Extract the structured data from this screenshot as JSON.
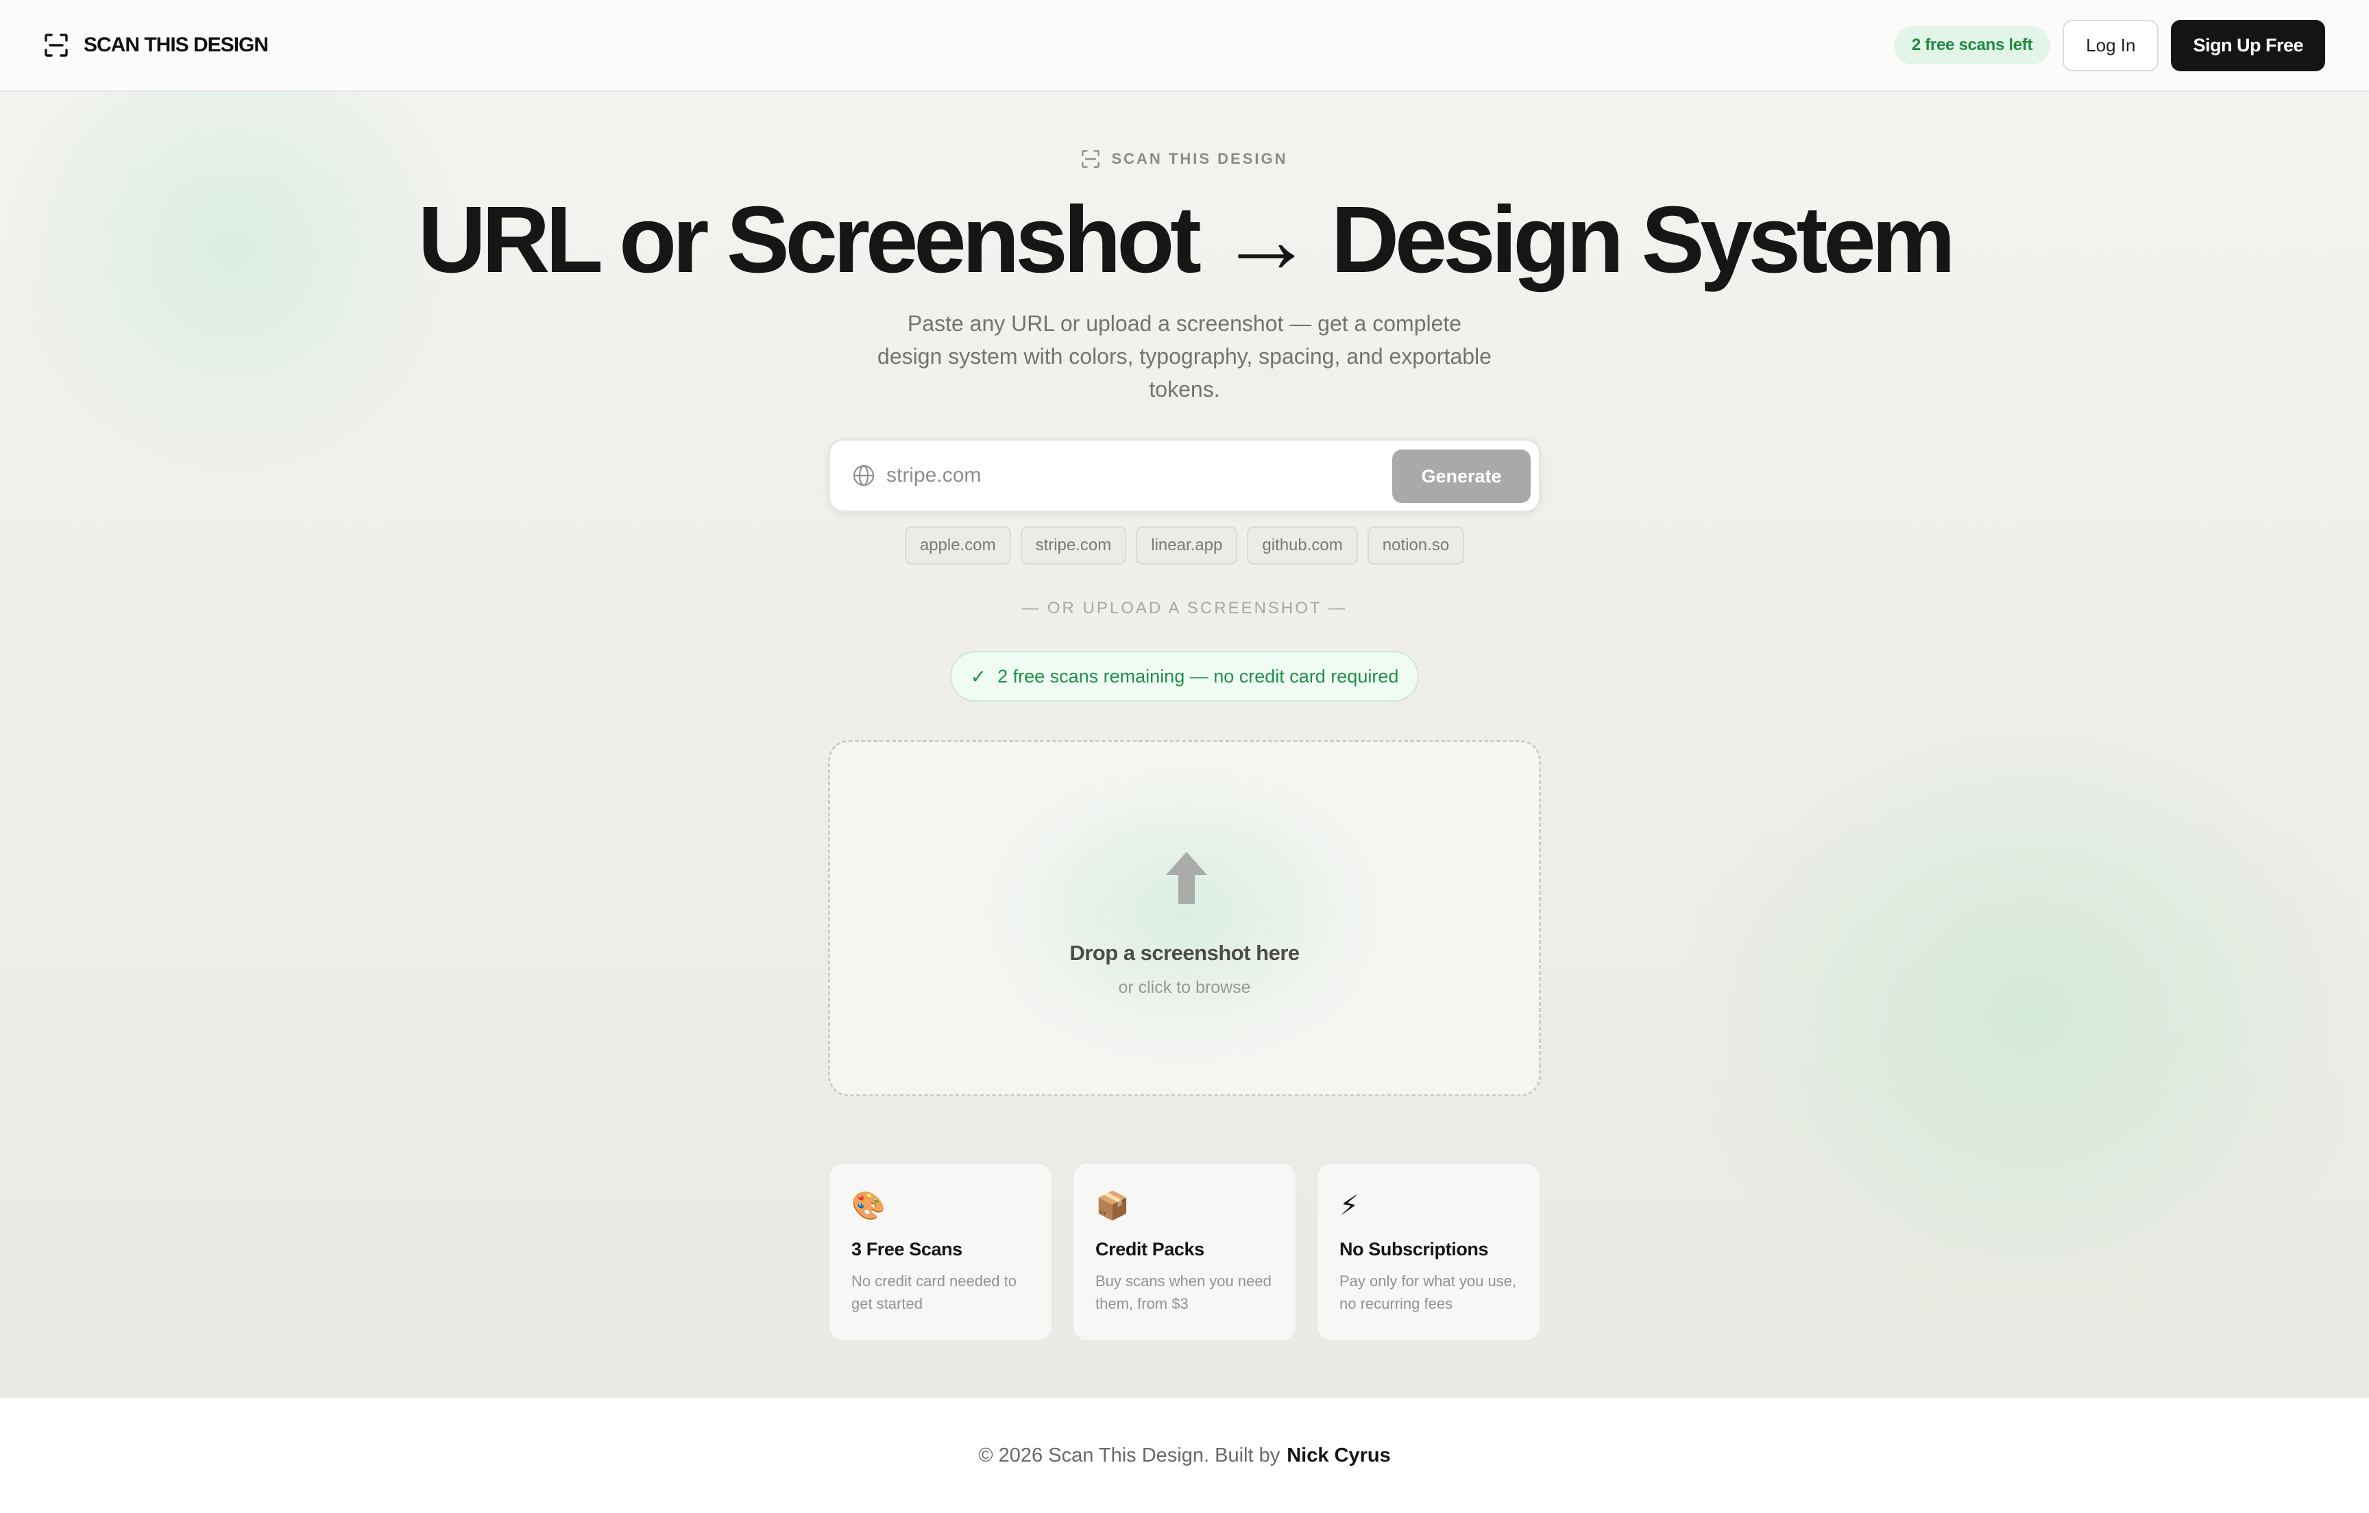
{
  "nav": {
    "brand": "SCAN THIS DESIGN",
    "scans_left": "2 free scans left",
    "login": "Log In",
    "signup": "Sign Up Free"
  },
  "hero": {
    "eyebrow": "SCAN THIS DESIGN",
    "headline": "URL or Screenshot → Design System",
    "subline": "Paste any URL or upload a screenshot — get a complete design system with colors, typography, spacing, and exportable tokens."
  },
  "url_form": {
    "placeholder": "stripe.com",
    "generate": "Generate",
    "examples": [
      "apple.com",
      "stripe.com",
      "linear.app",
      "github.com",
      "notion.so"
    ]
  },
  "divider": "— OR UPLOAD A SCREENSHOT —",
  "free_banner": {
    "check": "✓",
    "text": "2 free scans remaining — no credit card required"
  },
  "dropzone": {
    "title": "Drop a screenshot here",
    "subtitle": "or click to browse"
  },
  "features": [
    {
      "icon": "🎨",
      "title": "3 Free Scans",
      "desc": "No credit card needed to get started"
    },
    {
      "icon": "📦",
      "title": "Credit Packs",
      "desc": "Buy scans when you need them, from $3"
    },
    {
      "icon": "⚡",
      "title": "No Subscriptions",
      "desc": "Pay only for what you use, no recurring fees"
    }
  ],
  "footer": {
    "text": "© 2026 Scan This Design. Built by",
    "author": "Nick Cyrus"
  },
  "colors": {
    "accent_green": "#1f8a45",
    "dark": "#151515",
    "generate_disabled": "#a9a9a7"
  }
}
